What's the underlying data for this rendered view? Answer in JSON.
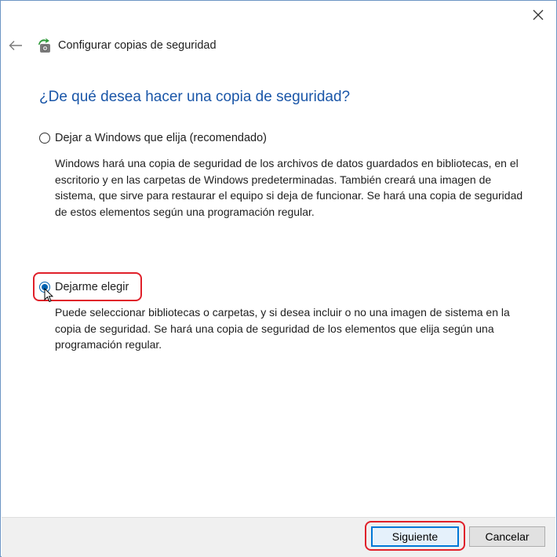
{
  "window": {
    "title": "Configurar copias de seguridad",
    "icons": {
      "close": "close-icon",
      "back": "back-arrow-icon",
      "app": "backup-app-icon"
    }
  },
  "heading": "¿De qué desea hacer una copia de seguridad?",
  "options": [
    {
      "label": "Dejar a Windows que elija (recomendado)",
      "checked": false,
      "description": "Windows hará una copia de seguridad de los archivos de datos guardados en bibliotecas, en el escritorio y en las carpetas de Windows predeterminadas. También creará una imagen de sistema, que sirve para restaurar el equipo si deja de funcionar. Se hará una copia de seguridad de estos elementos según una programación regular."
    },
    {
      "label": "Dejarme elegir",
      "checked": true,
      "description": "Puede seleccionar bibliotecas o carpetas, y si desea incluir o no una imagen de sistema en la copia de seguridad. Se hará una copia de seguridad de los elementos que elija según una programación regular."
    }
  ],
  "footer": {
    "next_label": "Siguiente",
    "cancel_label": "Cancelar"
  },
  "colors": {
    "heading": "#1a56a8",
    "accent": "#0078d7",
    "highlight": "#e0202a"
  }
}
